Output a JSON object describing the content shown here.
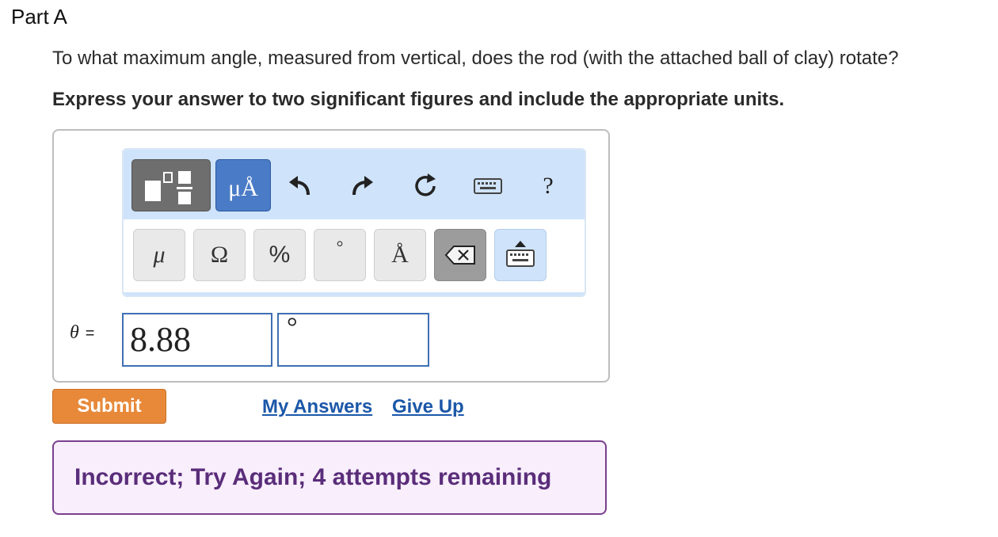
{
  "part": {
    "title": "Part A"
  },
  "question": {
    "text": "To what maximum angle, measured from vertical, does the rod (with the attached ball of clay) rotate?",
    "instruction": "Express your answer to two significant figures and include the appropriate units."
  },
  "toolbar": {
    "units_button": "μÅ",
    "help_label": "?",
    "keys": [
      {
        "label": "μ"
      },
      {
        "label": "Ω"
      },
      {
        "label": "%"
      },
      {
        "label": "°"
      },
      {
        "label": "Å"
      }
    ]
  },
  "answer": {
    "variable": "θ",
    "equals": "=",
    "value": "8.88",
    "unit": "°"
  },
  "actions": {
    "submit": "Submit",
    "my_answers": "My Answers",
    "give_up": "Give Up"
  },
  "feedback": {
    "text": "Incorrect; Try Again; 4 attempts remaining"
  },
  "colors": {
    "submit": "#e8893a",
    "link": "#1b57a8",
    "feedback_border": "#7a3f8f",
    "toolbar_bg": "#cfe3fb",
    "units_button": "#4a7bc6"
  }
}
